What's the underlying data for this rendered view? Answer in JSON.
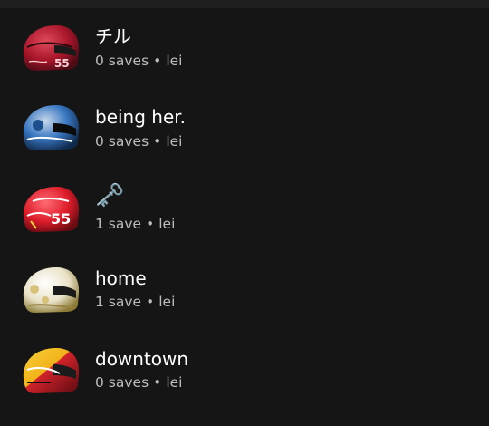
{
  "playlists": [
    {
      "title": "チル",
      "count": "0 saves",
      "separator": "•",
      "owner": "lei",
      "thumb_icon": "helmet-red-black-icon",
      "accent": "#c41e2e"
    },
    {
      "title": "being her.",
      "count": "0 saves",
      "separator": "•",
      "owner": "lei",
      "thumb_icon": "helmet-blue-white-icon",
      "accent": "#1f5fa8"
    },
    {
      "title": "🗝️",
      "count": "1 save",
      "separator": "•",
      "owner": "lei",
      "thumb_icon": "helmet-red-55-icon",
      "accent": "#e5232b"
    },
    {
      "title": "home",
      "count": "1 save",
      "separator": "•",
      "owner": "lei",
      "thumb_icon": "helmet-white-gold-icon",
      "accent": "#d7c27a"
    },
    {
      "title": "downtown",
      "count": "0 saves",
      "separator": "•",
      "owner": "lei",
      "thumb_icon": "helmet-red-yellow-icon",
      "accent": "#f2b21a"
    }
  ]
}
